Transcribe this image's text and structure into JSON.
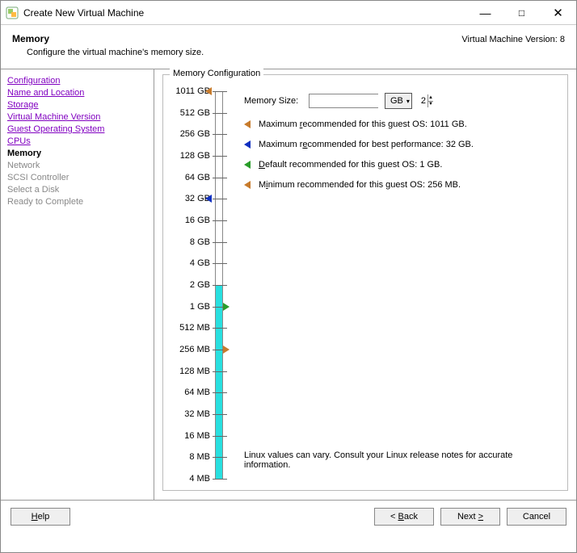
{
  "window": {
    "title": "Create New Virtual Machine"
  },
  "header": {
    "title": "Memory",
    "subtitle": "Configure the virtual machine's memory size.",
    "version": "Virtual Machine Version: 8"
  },
  "sidebar": {
    "links": [
      "Configuration",
      "Name and Location",
      "Storage",
      "Virtual Machine Version",
      "Guest Operating System",
      "CPUs"
    ],
    "current": "Memory",
    "disabled": [
      "Network",
      "SCSI Controller",
      "Select a Disk",
      "Ready to Complete"
    ]
  },
  "fieldset": {
    "legend": "Memory Configuration"
  },
  "memory": {
    "label": "Memory Size:",
    "value": "2",
    "unit": "GB"
  },
  "recs": {
    "max_a": "Maximum ",
    "max_u": "r",
    "max_b": "ecommended for this guest OS: 1011 GB.",
    "perf_a": "Maximum r",
    "perf_u": "e",
    "perf_b": "commended for best performance: 32 GB.",
    "def_a": "",
    "def_u": "D",
    "def_b": "efault recommended for this guest OS: 1 GB.",
    "min_a": "M",
    "min_u": "i",
    "min_b": "nimum recommended for this guest OS: 256 MB."
  },
  "chart_data": {
    "type": "bar",
    "ticks": [
      "1011 GB",
      "512 GB",
      "256 GB",
      "128 GB",
      "64 GB",
      "32 GB",
      "16 GB",
      "8 GB",
      "4 GB",
      "2 GB",
      "1 GB",
      "512 MB",
      "256 MB",
      "128 MB",
      "64 MB",
      "32 MB",
      "16 MB",
      "8 MB",
      "4 MB"
    ],
    "selected_value": "2 GB",
    "markers": [
      {
        "at": "1011 GB",
        "color": "orange",
        "side": "left",
        "meaning": "max recommended"
      },
      {
        "at": "32 GB",
        "color": "blue",
        "side": "left",
        "meaning": "max for best performance"
      },
      {
        "at": "1 GB",
        "color": "green",
        "side": "right",
        "meaning": "default"
      },
      {
        "at": "256 MB",
        "color": "orange",
        "side": "right",
        "meaning": "minimum"
      }
    ]
  },
  "footnote": "Linux values can vary. Consult your Linux release notes for accurate information.",
  "buttons": {
    "help": "Help",
    "back": "< Back",
    "next": "Next >",
    "cancel": "Cancel",
    "help_u": "H",
    "back_u": "B",
    "next_u": ">"
  }
}
